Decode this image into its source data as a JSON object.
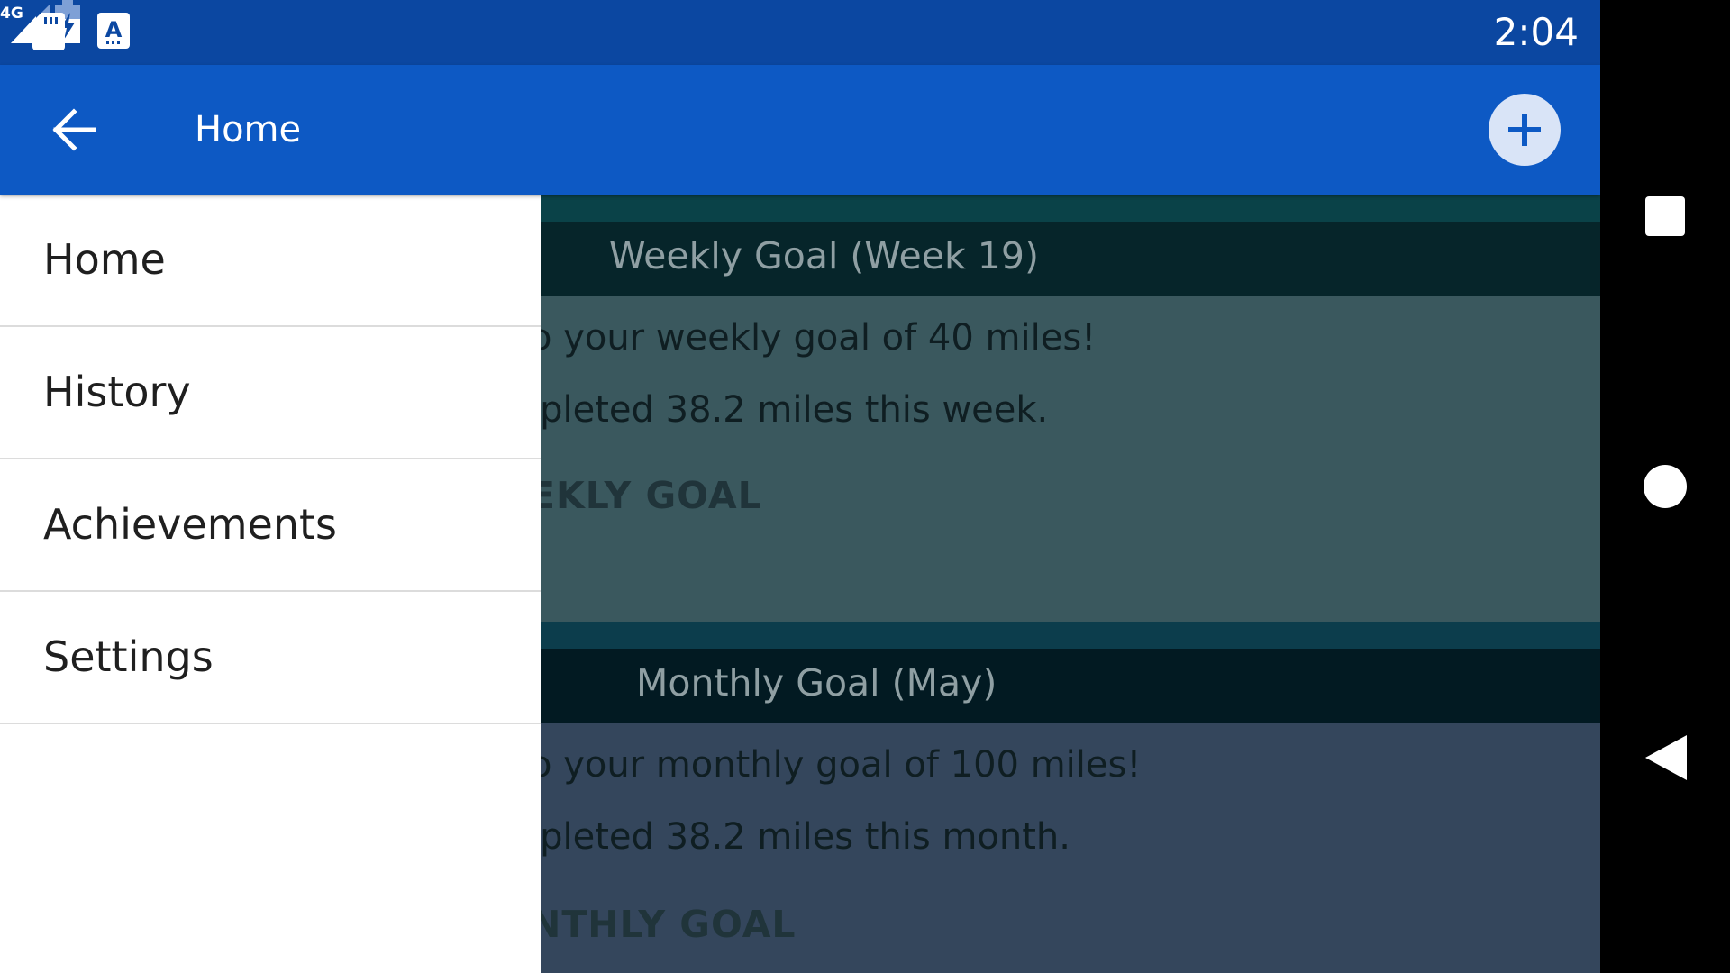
{
  "status_bar": {
    "time": "2:04",
    "network": "4G",
    "icons": [
      "sd-card-icon",
      "keyboard-icon",
      "signal-icon",
      "battery-charging-icon"
    ]
  },
  "app_bar": {
    "title": "Home",
    "back_icon": "arrow-left-icon",
    "add_icon": "plus-icon"
  },
  "drawer": {
    "items": [
      {
        "label": "Home"
      },
      {
        "label": "History"
      },
      {
        "label": "Achievements"
      },
      {
        "label": "Settings"
      }
    ]
  },
  "weekly_card": {
    "title": "Weekly Goal (Week 19)",
    "line1": "o your weekly goal of 40 miles!",
    "line2": "ıpleted 38.2 miles this week.",
    "button": "EKLY GOAL"
  },
  "monthly_card": {
    "title": "Monthly Goal (May)",
    "line1": "o your monthly goal of 100 miles!",
    "line2": "ıpleted 38.2 miles this month.",
    "button": "NTHLY GOAL"
  },
  "nav_bar": {
    "icons": [
      "recents-icon",
      "home-icon",
      "back-icon"
    ]
  },
  "colors": {
    "status_bar": "#0b47a1",
    "app_bar": "#0d59c4",
    "drawer": "#ffffff",
    "nav_bar": "#000000"
  }
}
